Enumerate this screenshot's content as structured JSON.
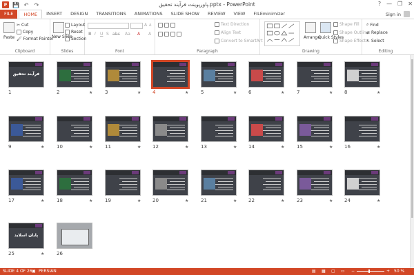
{
  "window": {
    "title": "پاورپوینت فرآیند تحقیق.pptx - PowerPoint"
  },
  "qat": {
    "save": "💾",
    "undo": "↶",
    "redo": "↷"
  },
  "window_controls": {
    "help": "?",
    "minimize": "—",
    "restore": "❐",
    "close": "✕"
  },
  "tabs": [
    "FILE",
    "HOME",
    "INSERT",
    "DESIGN",
    "TRANSITIONS",
    "ANIMATIONS",
    "SLIDE SHOW",
    "REVIEW",
    "VIEW",
    "FILEminimizer"
  ],
  "active_tab": "HOME",
  "sign_in": "Sign in",
  "ribbon": {
    "clipboard": {
      "paste": "Paste",
      "cut": "Cut",
      "copy": "Copy",
      "format_painter": "Format Painter",
      "label": "Clipboard"
    },
    "slides": {
      "new_slide": "New Slide",
      "layout": "Layout",
      "reset": "Reset",
      "section": "Section",
      "label": "Slides"
    },
    "font": {
      "label": "Font",
      "bold": "B",
      "italic": "I",
      "underline": "U",
      "shadow": "S",
      "strike": "abc",
      "case": "Aa",
      "grow": "A",
      "shrink": "A",
      "clear": "A",
      "color": "A"
    },
    "paragraph": {
      "text_direction": "Text Direction",
      "align_text": "Align Text",
      "convert_smartart": "Convert to SmartArt",
      "label": "Paragraph"
    },
    "drawing": {
      "arrange": "Arrange",
      "quick_styles": "Quick Styles",
      "shape_fill": "Shape Fill",
      "shape_outline": "Shape Outline",
      "shape_effects": "Shape Effects",
      "label": "Drawing"
    },
    "editing": {
      "find": "Find",
      "replace": "Replace",
      "select": "Select",
      "label": "Editing"
    }
  },
  "slides": [
    {
      "num": "1",
      "title": "فرآیند تحقیق",
      "star": ""
    },
    {
      "num": "2",
      "star": "★"
    },
    {
      "num": "3",
      "star": "★"
    },
    {
      "num": "4",
      "star": "★"
    },
    {
      "num": "5",
      "star": "★"
    },
    {
      "num": "6",
      "star": "★"
    },
    {
      "num": "7",
      "star": "★"
    },
    {
      "num": "8",
      "star": "★"
    },
    {
      "num": "9",
      "star": "★"
    },
    {
      "num": "10",
      "star": "★"
    },
    {
      "num": "11",
      "star": "★"
    },
    {
      "num": "12",
      "star": "★"
    },
    {
      "num": "13",
      "star": "★"
    },
    {
      "num": "14",
      "star": "★"
    },
    {
      "num": "15",
      "star": "★"
    },
    {
      "num": "16",
      "star": "★"
    },
    {
      "num": "17",
      "star": "★"
    },
    {
      "num": "18",
      "star": "★"
    },
    {
      "num": "19",
      "star": "★"
    },
    {
      "num": "20",
      "star": "★"
    },
    {
      "num": "21",
      "star": "★"
    },
    {
      "num": "22",
      "star": "★"
    },
    {
      "num": "23",
      "star": "★"
    },
    {
      "num": "24",
      "star": "★"
    },
    {
      "num": "25",
      "title": "پایان اسلاید",
      "star": "★"
    },
    {
      "num": "26",
      "star": ""
    }
  ],
  "selected_slide": "4",
  "status": {
    "slide": "SLIDE 4 OF 26",
    "language": "PERSIAN",
    "zoom": "50 %"
  },
  "colors": {
    "accent": "#d24726",
    "slide_bg": "#3f4249"
  }
}
